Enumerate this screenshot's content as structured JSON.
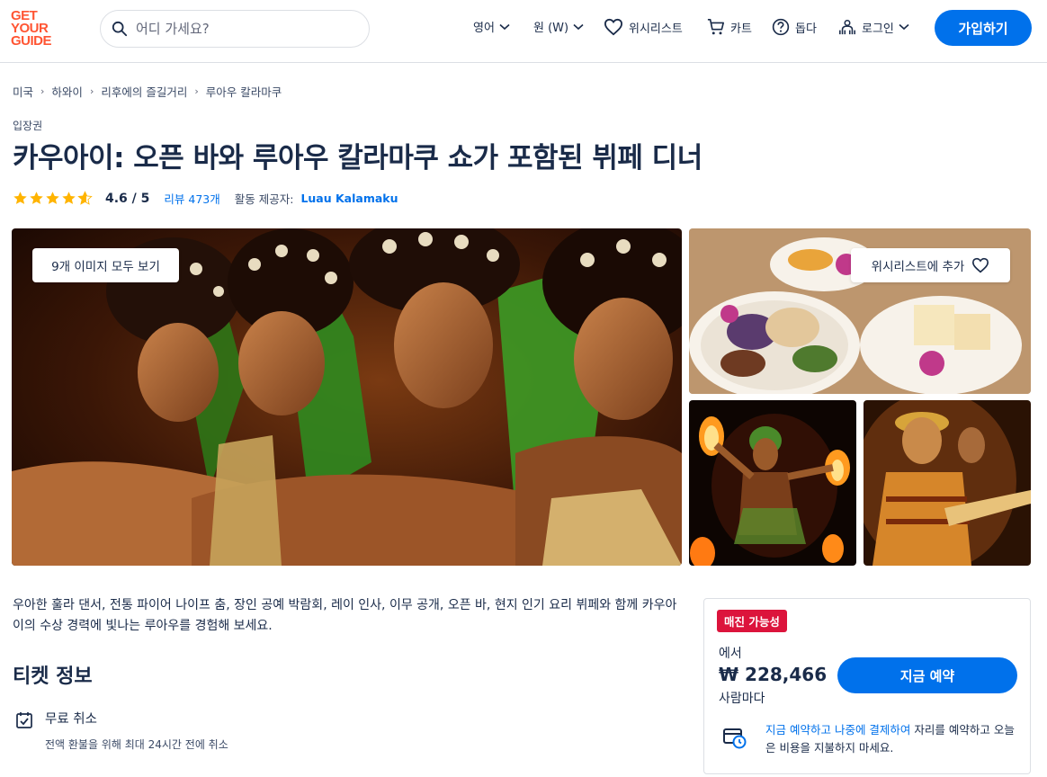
{
  "header": {
    "logo_lines": [
      "GET",
      "YOUR",
      "GUIDE"
    ],
    "search_placeholder": "어디 가세요?",
    "language": "영어",
    "currency": "원 (W)",
    "wishlist": "위시리스트",
    "cart": "카트",
    "help": "돕다",
    "login": "로그인",
    "signup": "가입하기"
  },
  "breadcrumb": [
    "미국",
    "하와이",
    "리후에의 즐길거리",
    "루아우 칼라마쿠"
  ],
  "category": "입장권",
  "title": "카우아이: 오픈 바와 루아우 칼라마쿠 쇼가 포함된 뷔페 디너",
  "rating": {
    "stars": 4.6,
    "value": "4.6 / 5",
    "reviews": "리뷰 473개",
    "provider_label": "활동 제공자:",
    "provider": "Luau Kalamaku"
  },
  "gallery": {
    "view_all": "9개 이미지 모두 보기",
    "add_wishlist": "위시리스트에 추가"
  },
  "description": "우아한 훌라 댄서, 전통 파이어 나이프 춤, 장인 공예 박람회, 레이 인사, 이무 공개, 오픈 바, 현지 인기 요리 뷔페와 함께 카우아이의 수상 경력에 빛나는 루아우를 경험해 보세요.",
  "ticket_info": {
    "heading": "티켓 정보",
    "free_cancel_title": "무료 취소",
    "free_cancel_sub": "전액 환불을 위해 최대 24시간 전에 취소"
  },
  "booking": {
    "badge": "매진 가능성",
    "from": "에서",
    "price": "₩ 228,466",
    "per": "사람마다",
    "cta": "지금 예약",
    "reserve_link": "지금 예약하고 나중에 결제하여",
    "reserve_rest": " 자리를 예약하고 오늘은 비용을 지불하지 마세요."
  },
  "colors": {
    "brand_orange": "#ff5533",
    "primary_blue": "#0071eb",
    "badge_red": "#dc143c",
    "star_yellow": "#ffb400"
  }
}
